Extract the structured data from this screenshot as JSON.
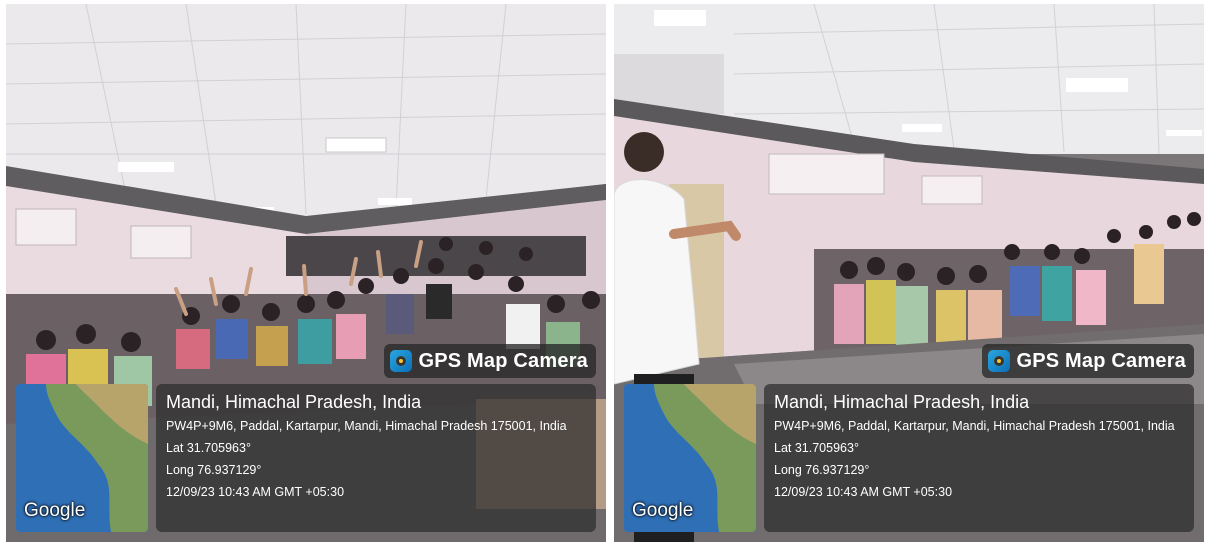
{
  "photos": [
    {
      "id_label": "left",
      "badge": "GPS Map Camera",
      "map_brand": "Google",
      "location_title": "Mandi, Himachal Pradesh, India",
      "address": "PW4P+9M6, Paddal, Kartarpur, Mandi, Himachal Pradesh 175001, India",
      "lat": "Lat 31.705963°",
      "long": "Long 76.937129°",
      "datetime": "12/09/23 10:43 AM GMT +05:30"
    },
    {
      "id_label": "right",
      "badge": "GPS Map Camera",
      "map_brand": "Google",
      "location_title": "Mandi, Himachal Pradesh, India",
      "address": "PW4P+9M6, Paddal, Kartarpur, Mandi, Himachal Pradesh 175001, India",
      "lat": "Lat 31.705963°",
      "long": "Long 76.937129°",
      "datetime": "12/09/23 10:43 AM GMT +05:30"
    }
  ],
  "colors": {
    "ceiling": "#e9e7ea",
    "wall": "#e8d8de",
    "floor": "#6d6a6b",
    "overlay": "#2d2d2d",
    "map_sea": "#2f6fb5",
    "map_land": "#7a9a5c"
  }
}
